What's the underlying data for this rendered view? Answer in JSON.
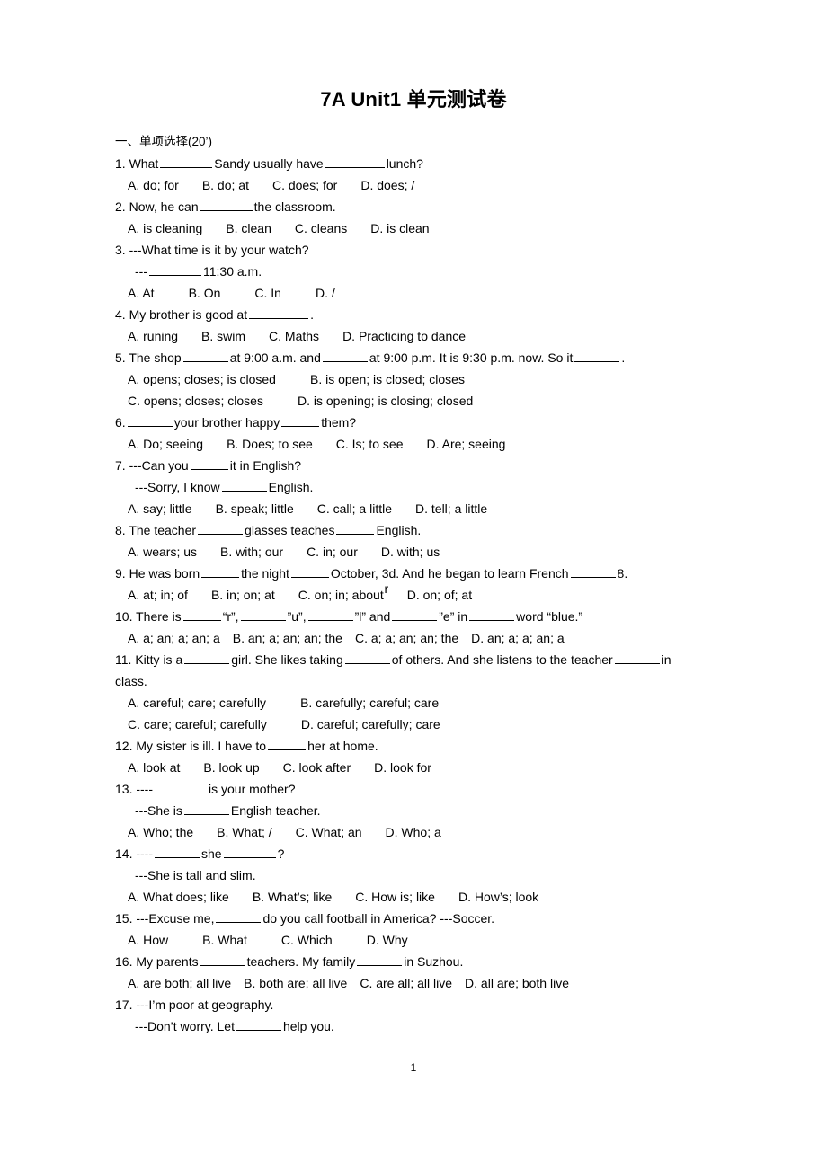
{
  "document": {
    "title": "7A Unit1  单元测试卷",
    "page_number": "1"
  },
  "section": {
    "heading": "一、单项选择(20’)"
  },
  "questions": [
    {
      "number": "1.",
      "stem_a": "What",
      "stem_b": "Sandy usually have",
      "stem_c": "lunch?",
      "options": [
        "A. do; for",
        "B. do; at",
        "C. does; for",
        "D. does; /"
      ]
    },
    {
      "number": "2.",
      "stem_a": "Now, he can",
      "stem_b": "the classroom.",
      "options": [
        "A. is cleaning",
        "B. clean",
        "C. cleans",
        "D. is clean"
      ]
    },
    {
      "number": "3.",
      "stem_a": "---What time is it by your watch?",
      "sub_a": "---",
      "sub_b": "11:30 a.m.",
      "options": [
        "A. At",
        "B. On",
        "C. In",
        "D. /"
      ]
    },
    {
      "number": "4.",
      "stem_a": "My brother is good at",
      "stem_b": ".",
      "options": [
        "A. runing",
        "B. swim",
        "C. Maths",
        "D. Practicing to dance"
      ]
    },
    {
      "number": "5.",
      "stem_a": "The shop",
      "stem_b": "at 9:00 a.m. and",
      "stem_c": "at 9:00 p.m. It is 9:30 p.m. now. So it",
      "stem_d": ".",
      "options": [
        "A. opens; closes; is closed",
        "B. is open; is closed; closes",
        "C. opens; closes; closes",
        "D. is opening; is closing; closed"
      ]
    },
    {
      "number": "6.",
      "stem_a": "",
      "stem_b": "your brother happy",
      "stem_c": "them?",
      "options": [
        "A. Do; seeing",
        "B. Does; to see",
        "C. Is; to see",
        "D. Are; seeing"
      ]
    },
    {
      "number": "7.",
      "stem_a": "---Can you",
      "stem_b": "it in English?",
      "sub_a": "---Sorry, I know",
      "sub_b": "English.",
      "options": [
        "A. say; little",
        "B. speak; little",
        "C. call; a little",
        "D. tell; a little"
      ]
    },
    {
      "number": "8.",
      "stem_a": "The teacher",
      "stem_b": "glasses teaches",
      "stem_c": "English.",
      "options": [
        "A. wears; us",
        "B. with; our",
        "C. in; our",
        "D. with; us"
      ]
    },
    {
      "number": "9.",
      "stem_a": "He was born",
      "stem_b": "the night",
      "stem_c": "October, 3",
      "stem_ord": "r",
      "stem_c2": "d. And he began to learn French",
      "stem_d": "8.",
      "options": [
        "A. at; in; of",
        "B. in; on; at",
        "C. on; in; about",
        "D. on; of; at"
      ]
    },
    {
      "number": "10.",
      "stem_a": "There is",
      "stem_b": "“r”,",
      "stem_c": "”u”,",
      "stem_d": "”l” and",
      "stem_e": "”e” in",
      "stem_f": "word “blue.”",
      "options": [
        "A. a; an; a; an; a",
        "B. an; a; an; an; the",
        "C. a; a; an; an; the",
        "D. an; a; a; an; a"
      ]
    },
    {
      "number": "11.",
      "stem_a": "Kitty is a",
      "stem_b": "girl. She likes taking",
      "stem_c": "of others. And she listens to the teacher",
      "stem_d": "in class.",
      "options": [
        "A. careful; care; carefully",
        "B. carefully; careful; care",
        "C. care; careful; carefully",
        "D. careful; carefully; care"
      ]
    },
    {
      "number": "12.",
      "stem_a": "My sister is ill. I have to",
      "stem_b": "her at home.",
      "options": [
        "A. look at",
        "B. look up",
        "C. look after",
        "D. look for"
      ]
    },
    {
      "number": "13.",
      "stem_a": "----",
      "stem_b": "is your mother?",
      "sub_a": "---She is",
      "sub_b": "English teacher.",
      "options": [
        "A. Who; the",
        "B. What; /",
        "C. What; an",
        "D. Who; a"
      ]
    },
    {
      "number": "14.",
      "stem_a": "----",
      "stem_b": "she",
      "stem_c": "?",
      "sub_a": "---She is tall and slim.",
      "options": [
        "A. What does; like",
        "B. What’s; like",
        "C. How is; like",
        "D. How’s; look"
      ]
    },
    {
      "number": "15.",
      "stem_a": "---Excuse me,",
      "stem_b": "do you call football in America? ---Soccer.",
      "options": [
        "A. How",
        "B. What",
        "C. Which",
        "D. Why"
      ]
    },
    {
      "number": "16.",
      "stem_a": "My parents",
      "stem_b": "teachers. My family",
      "stem_c": "in Suzhou.",
      "options": [
        "A. are both; all live",
        "B. both are; all live",
        "C. are all; all live",
        "D. all are; both live"
      ]
    },
    {
      "number": "17.",
      "stem_a": "---I’m poor at geography.",
      "sub_a": "---Don’t worry. Let",
      "sub_b": "help you."
    }
  ]
}
